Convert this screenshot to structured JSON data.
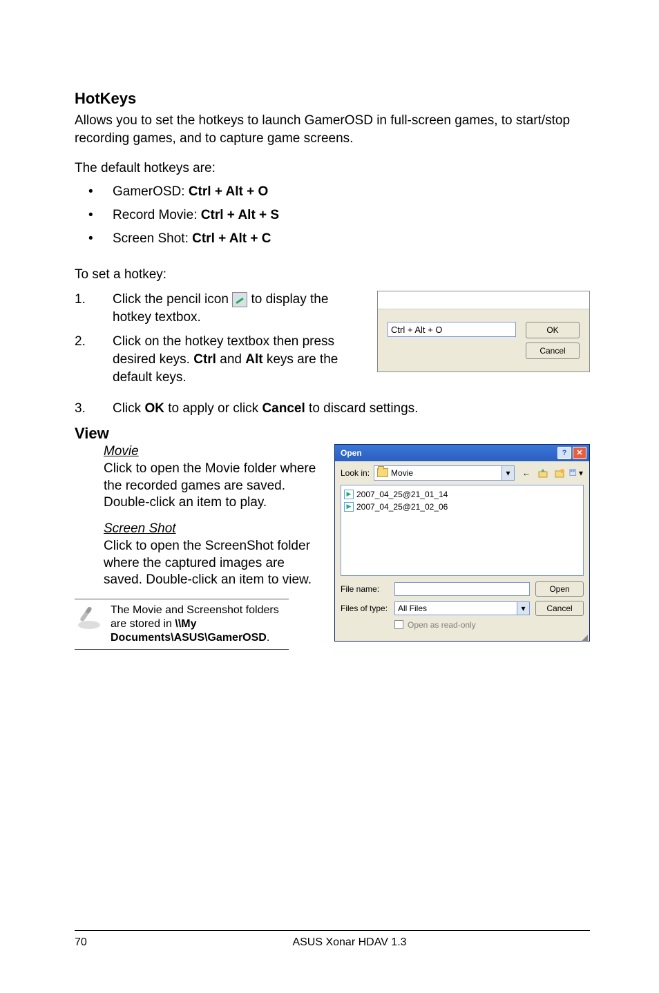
{
  "title": "HotKeys",
  "intro": "Allows you to set the hotkeys to launch GamerOSD in full-screen games, to start/stop recording games, and to capture game screens.",
  "defaults_intro": "The default hotkeys are:",
  "defaults": [
    {
      "label": "GamerOSD: ",
      "keys": "Ctrl + Alt + O"
    },
    {
      "label": "Record Movie: ",
      "keys": "Ctrl + Alt + S"
    },
    {
      "label": "Screen Shot: ",
      "keys": "Ctrl + Alt + C"
    }
  ],
  "set_intro": "To set a hotkey:",
  "steps": {
    "s1a": "Click the pencil icon ",
    "s1b": " to display the hotkey textbox.",
    "s2a": "Click on the hotkey textbox then press desired keys. ",
    "s2b": "Ctrl",
    "s2c": " and ",
    "s2d": "Alt",
    "s2e": " keys are the default keys.",
    "s3a": "Click ",
    "s3b": "OK",
    "s3c": " to apply or click ",
    "s3d": "Cancel",
    "s3e": " to discard settings."
  },
  "hotkey_dlg": {
    "value": "Ctrl + Alt + O",
    "ok": "OK",
    "cancel": "Cancel"
  },
  "view": {
    "title": "View",
    "movie": {
      "heading": "Movie",
      "desc": "Click to open the Movie folder where the recorded games are saved. Double-click an item to play."
    },
    "screen": {
      "heading": "Screen Shot",
      "desc": "Click to open the ScreenShot folder where the captured images are saved. Double-click an item to view."
    },
    "note": {
      "a": "The Movie and Screenshot folders are stored in ",
      "b": "\\\\My Documents\\ASUS\\GamerOSD",
      "c": "."
    }
  },
  "open_dlg": {
    "caption": "Open",
    "look_in_label": "Look in:",
    "look_in_value": "Movie",
    "files": [
      "2007_04_25@21_01_14",
      "2007_04_25@21_02_06"
    ],
    "file_name_label": "File name:",
    "file_name_value": "",
    "files_type_label": "Files of type:",
    "files_type_value": "All Files",
    "open_btn": "Open",
    "cancel_btn": "Cancel",
    "readonly": "Open as read-only"
  },
  "footer": {
    "page": "70",
    "title": "ASUS Xonar HDAV 1.3"
  }
}
